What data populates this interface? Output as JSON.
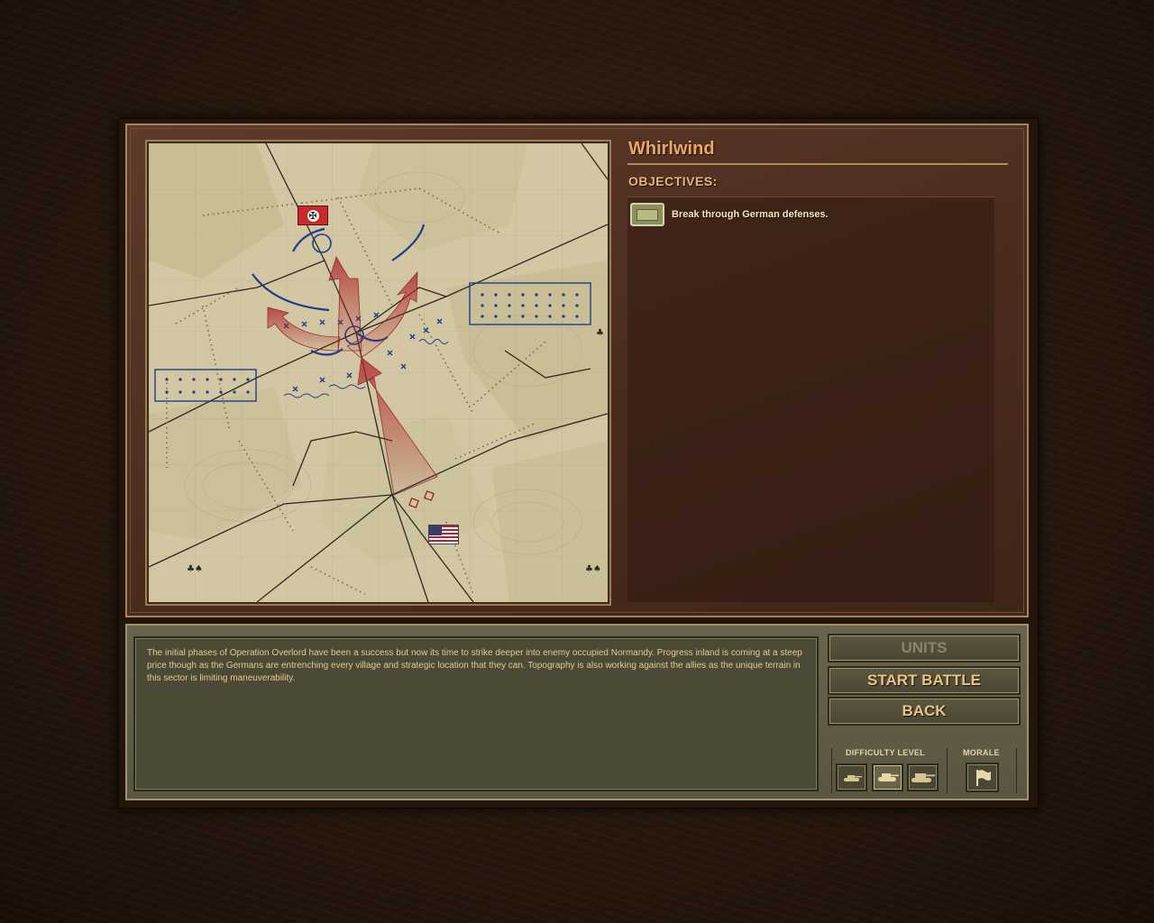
{
  "mission": {
    "title": "Whirlwind",
    "objectives_label": "OBJECTIVES:",
    "objectives": [
      {
        "text": "Break through German defenses.",
        "icon": "objective-marker-icon"
      }
    ]
  },
  "briefing": {
    "text": "The initial phases of Operation Overlord have been a success but now its time to strike deeper into enemy occupied Normandy. Progress inland is coming at a steep price though as the Germans are entrenching every village and strategic location that they can. Topography is also working against the allies as the unique terrain in this sector is limiting maneuverability."
  },
  "buttons": {
    "units": "UNITS",
    "start_battle": "START BATTLE",
    "back": "BACK"
  },
  "difficulty": {
    "label": "DIFFICULTY LEVEL",
    "levels": [
      "light-tank-icon",
      "medium-tank-icon",
      "heavy-tank-icon"
    ],
    "selected_index": 1
  },
  "morale": {
    "label": "MORALE",
    "icon": "flag-icon"
  },
  "map": {
    "enemy_flag": "german-flag-icon",
    "allied_flag": "us-flag-icon",
    "colors": {
      "terrain": "#cfc49e",
      "enemy": "#1e3c8c",
      "attack_arrow": "#b0242a"
    }
  }
}
